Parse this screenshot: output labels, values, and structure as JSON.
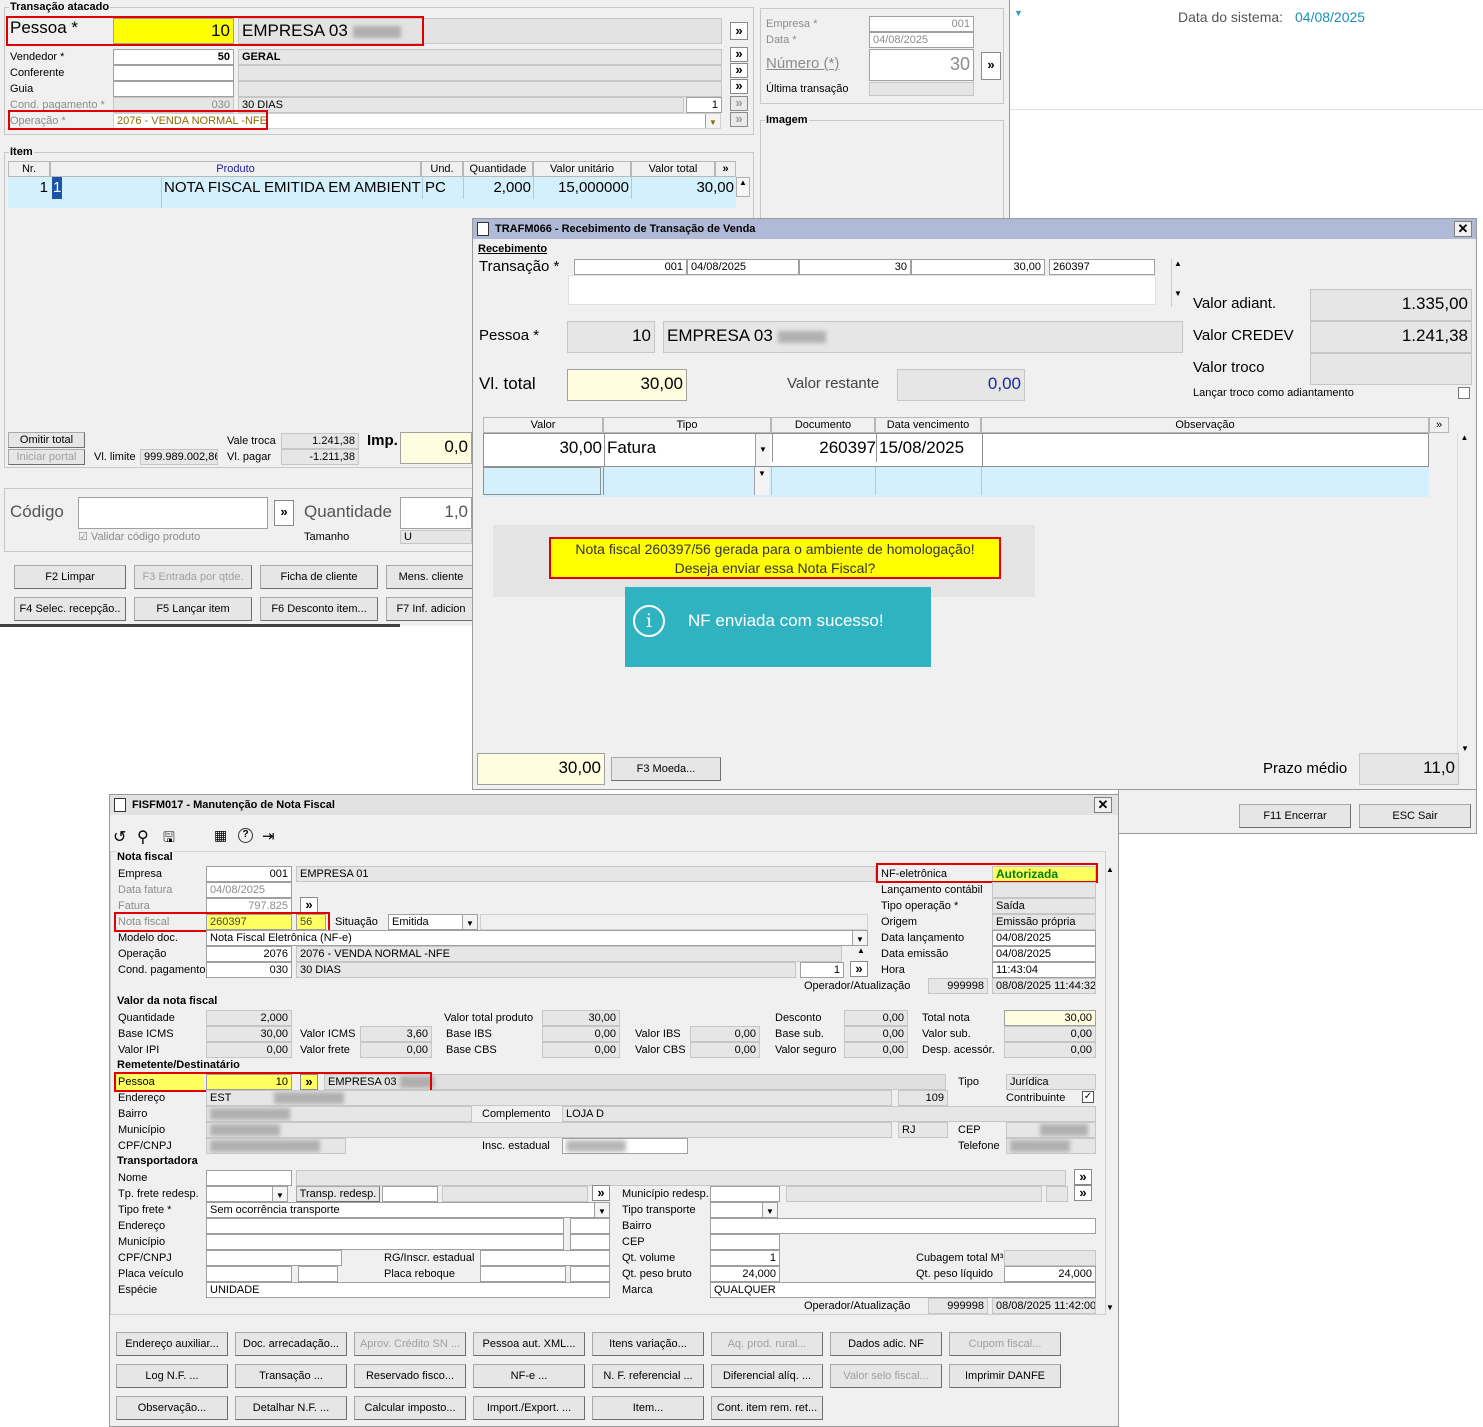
{
  "page": {
    "system_date_label": "Data do sistema:",
    "system_date": "04/08/2025"
  },
  "transacao": {
    "title": "Transação atacado",
    "pessoa_label": "Pessoa *",
    "pessoa_code": "10",
    "pessoa_name": "EMPRESA 03",
    "vendedor_label": "Vendedor *",
    "vendedor_code": "50",
    "vendedor_name": "GERAL",
    "conferente_label": "Conferente",
    "guia_label": "Guia",
    "cond_label": "Cond. pagamento *",
    "cond_code": "030",
    "cond_name": "30 DIAS",
    "cond_parcelas": "1",
    "operacao_label": "Operação *",
    "operacao_value": "2076 - VENDA NORMAL -NFE",
    "empresa_label": "Empresa *",
    "empresa_value": "001",
    "data_label": "Data *",
    "data_value": "04/08/2025",
    "numero_label": "Número (*)",
    "numero_value": "30",
    "ultima_label": "Última transação",
    "imagem_label": "Imagem",
    "item_label": "Item",
    "cols": [
      "Nr.",
      "Produto",
      "Und.",
      "Quantidade",
      "Valor unitário",
      "Valor total"
    ],
    "row": {
      "nr": "1",
      "cod": "1",
      "produto": "NOTA FISCAL EMITIDA EM AMBIENTE",
      "und": "PC",
      "qtd": "2,000",
      "vunit": "15,000000",
      "vtotal": "30,00"
    },
    "omitir": "Omitir total",
    "iniciar": "Iniciar portal",
    "vl_limite_label": "Vl. limite",
    "vl_limite": "999.989.002,86",
    "vale_troca_label": "Vale troca",
    "vale_troca": "1.241,38",
    "vl_pagar_label": "Vl. pagar",
    "vl_pagar": "-1.211,38",
    "imp_label": "Imp.",
    "imp_value": "0,0",
    "codigo_label": "Código",
    "quantidade_label": "Quantidade",
    "quantidade_value": "1,0",
    "validar_label": "Validar código produto",
    "tamanho_label": "Tamanho",
    "tamanho_value": "U",
    "buttons": [
      "F2 Limpar",
      "F3 Entrada por qtde.",
      "Ficha de cliente",
      "Mens. cliente",
      "F4 Selec. recepção..",
      "F5 Lançar item",
      "F6 Desconto item...",
      "F7 Inf. adicion"
    ]
  },
  "receb": {
    "title": "TRAFM066 - Recebimento de Transação de Venda",
    "group": "Recebimento",
    "transacao_label": "Transação *",
    "trans": [
      "001",
      "04/08/2025",
      "30",
      "30,00",
      "260397"
    ],
    "pessoa_label": "Pessoa *",
    "pessoa_code": "10",
    "pessoa_name": "EMPRESA 03",
    "vltotal_label": "Vl. total",
    "vltotal": "30,00",
    "vlrestante_label": "Valor restante",
    "vlrestante": "0,00",
    "adiant_label": "Valor adiant.",
    "adiant": "1.335,00",
    "credev_label": "Valor CREDEV",
    "credev": "1.241,38",
    "troco_label": "Valor troco",
    "lancar_label": "Lançar troco como adiantamento",
    "cols": [
      "Valor",
      "Tipo",
      "Documento",
      "Data vencimento",
      "Observação"
    ],
    "row": {
      "valor": "30,00",
      "tipo": "Fatura",
      "doc": "260397",
      "venc": "15/08/2025"
    },
    "msg1": "Nota fiscal 260397/56 gerada para o ambiente de homologação!",
    "msg2": "Deseja enviar essa Nota Fiscal?",
    "toast": "NF enviada com sucesso!",
    "bottom_total": "30,00",
    "f3": "F3 Moeda...",
    "prazo_label": "Prazo médio",
    "prazo": "11,0",
    "f11": "F11 Encerrar",
    "esc": "ESC Sair"
  },
  "nf": {
    "title": "FISFM017 - Manutenção de Nota Fiscal",
    "nf_group": "Nota fiscal",
    "empresa_label": "Empresa",
    "empresa_code": "001",
    "empresa_name": "EMPRESA 01",
    "data_fatura_label": "Data fatura",
    "data_fatura": "04/08/2025",
    "fatura_label": "Fatura",
    "fatura": "797.825",
    "nota_label": "Nota fiscal",
    "nota": "260397",
    "serie": "56",
    "situacao_label": "Situação",
    "situacao": "Emitida",
    "modelo_label": "Modelo doc.",
    "modelo": "Nota Fiscal Eletrônica (NF-e)",
    "operacao_label": "Operação",
    "operacao_code": "2076",
    "operacao_name": "2076 - VENDA NORMAL -NFE",
    "cond_label": "Cond. pagamento",
    "cond_code": "030",
    "cond_name": "30 DIAS",
    "cond_parc": "1",
    "nfe_label": "NF-eletrônica",
    "nfe_status": "Autorizada",
    "lanc_label": "Lançamento contábil",
    "tipo_op_label": "Tipo operação *",
    "tipo_op": "Saída",
    "origem_label": "Origem",
    "origem": "Emissão própria",
    "data_lanc_label": "Data lançamento",
    "data_lanc": "04/08/2025",
    "data_emis_label": "Data emissão",
    "data_emis": "04/08/2025",
    "hora_label": "Hora",
    "hora": "11:43:04",
    "oper_at_label": "Operador/Atualização",
    "oper_code": "999998",
    "oper_date": "08/08/2025 11:44:32",
    "valor_group": "Valor da nota fiscal",
    "quantidade_label": "Quantidade",
    "quantidade": "2,000",
    "base_icms_label": "Base ICMS",
    "base_icms": "30,00",
    "valor_icms_label": "Valor ICMS",
    "valor_icms": "3,60",
    "valor_ipi_label": "Valor IPI",
    "valor_ipi": "0,00",
    "valor_frete_label": "Valor frete",
    "valor_frete": "0,00",
    "vtp_label": "Valor total produto",
    "vtp": "30,00",
    "base_ibs_label": "Base IBS",
    "base_ibs": "0,00",
    "base_cbs_label": "Base CBS",
    "base_cbs": "0,00",
    "valor_ibs_label": "Valor IBS",
    "valor_ibs": "0,00",
    "valor_cbs_label": "Valor CBS",
    "valor_cbs": "0,00",
    "desconto_label": "Desconto",
    "desconto": "0,00",
    "base_sub_label": "Base sub.",
    "base_sub": "0,00",
    "valor_seguro_label": "Valor seguro",
    "valor_seguro": "0,00",
    "total_nota_label": "Total nota",
    "total_nota": "30,00",
    "valor_sub_label": "Valor sub.",
    "valor_sub": "0,00",
    "desp_label": "Desp. acessór.",
    "desp": "0,00",
    "rem_group": "Remetente/Destinatário",
    "pessoa_label": "Pessoa",
    "pessoa_code": "10",
    "pessoa_name": "EMPRESA 03",
    "tipo_label": "Tipo",
    "tipo": "Jurídica",
    "endereco_label": "Endereço",
    "endereco": "EST",
    "numero": "109",
    "contrib_label": "Contribuinte",
    "bairro_label": "Bairro",
    "complemento_label": "Complemento",
    "complemento": "LOJA D",
    "municipio_label": "Município",
    "uf": "RJ",
    "cep_label": "CEP",
    "cpf_label": "CPF/CNPJ",
    "insc_label": "Insc. estadual",
    "telefone_label": "Telefone",
    "transp_group": "Transportadora",
    "nome_label": "Nome",
    "tp_frete_redesp_label": "Tp. frete redesp.",
    "transp_redesp_label": "Transp. redesp.",
    "mun_redesp_label": "Município redesp.",
    "tipo_frete_label": "Tipo frete *",
    "tipo_frete": "Sem ocorrência transporte",
    "tipo_transp_label": "Tipo transporte",
    "t_endereco_label": "Endereço",
    "t_bairro_label": "Bairro",
    "t_municipio_label": "Município",
    "t_cep_label": "CEP",
    "t_cpf_label": "CPF/CNPJ",
    "rg_label": "RG/Inscr. estadual",
    "qt_volume_label": "Qt. volume",
    "qt_volume": "1",
    "cubagem_label": "Cubagem total M³",
    "placa_label": "Placa veículo",
    "placa_reb_label": "Placa reboque",
    "peso_bruto_label": "Qt. peso bruto",
    "peso_bruto": "24,000",
    "peso_liq_label": "Qt. peso líquido",
    "peso_liq": "24,000",
    "especie_label": "Espécie",
    "especie": "UNIDADE",
    "marca_label": "Marca",
    "marca": "QUALQUER",
    "oper2_code": "999998",
    "oper2_date": "08/08/2025 11:42:00",
    "buttons": [
      "Endereço auxiliar...",
      "Doc. arrecadação...",
      "Aprov. Crédito SN ...",
      "Pessoa aut. XML...",
      "Itens variação...",
      "Aq. prod. rural...",
      "Dados adic. NF",
      "Cupom fiscal...",
      "Log N.F. ...",
      "Transação ...",
      "Reservado fisco...",
      "NF-e ...",
      "N. F. referencial ...",
      "Diferencial alíq. ...",
      "Valor selo fiscal...",
      "Imprimir DANFE",
      "Observação...",
      "Detalhar N.F. ...",
      "Calcular imposto...",
      "Import./Export. ...",
      "Item...",
      "Cont. item rem. ret..."
    ]
  }
}
